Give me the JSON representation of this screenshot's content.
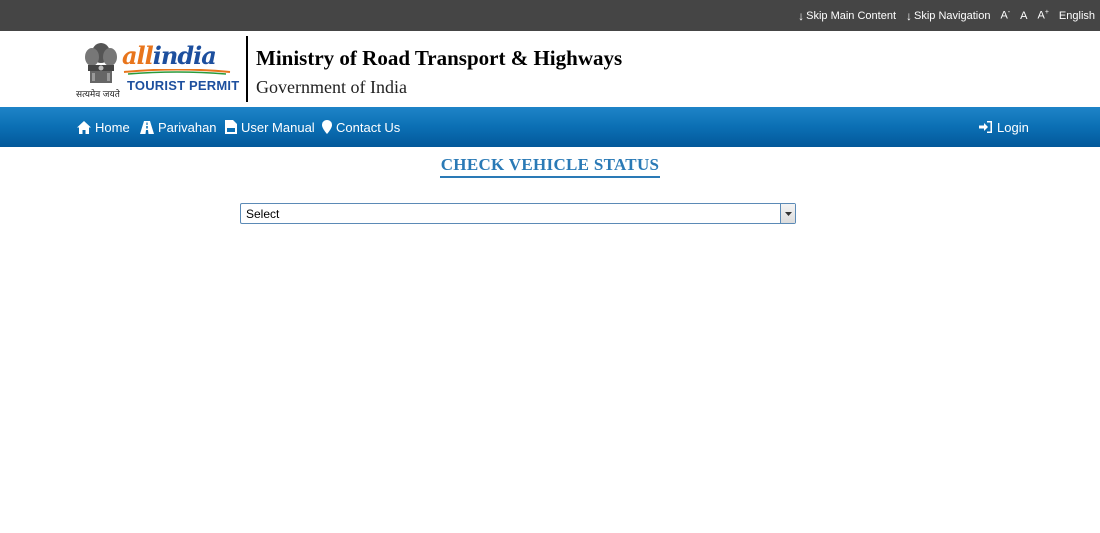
{
  "topbar": {
    "skip_main": "Skip Main Content",
    "skip_nav": "Skip Navigation",
    "font_decrease": "A",
    "font_decrease_sup": "-",
    "font_normal": "A",
    "font_increase": "A",
    "font_increase_sup": "+",
    "language": "English"
  },
  "header": {
    "logo_part1": "all",
    "logo_part2": "india",
    "logo_sub": "TOURIST PERMIT",
    "emblem_motto": "सत्यमेव जयते",
    "ministry": "Ministry of Road Transport & Highways",
    "government": "Government of India"
  },
  "nav": {
    "home": "Home",
    "parivahan": "Parivahan",
    "user_manual": "User Manual",
    "contact": "Contact Us",
    "login": "Login"
  },
  "main": {
    "title": "CHECK VEHICLE STATUS",
    "select_value": "Select"
  },
  "colors": {
    "topbar_bg": "#454545",
    "nav_blue": "#0b6fb4",
    "title_blue": "#2a7ab6",
    "logo_orange": "#e8751c",
    "logo_blue": "#1d4f9e"
  }
}
